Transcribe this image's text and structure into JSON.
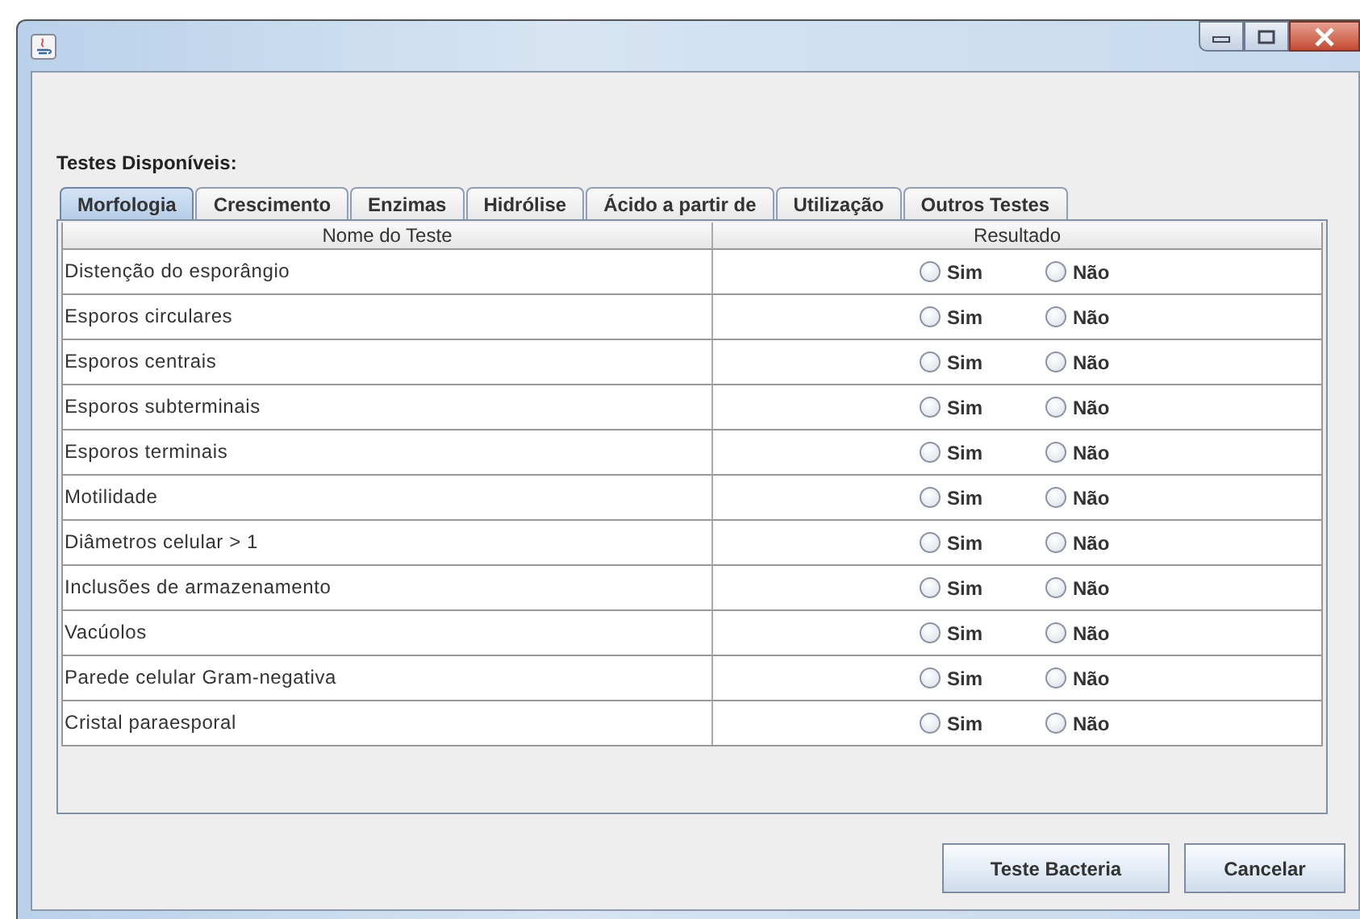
{
  "section_label": "Testes Disponíveis:",
  "tabs": [
    {
      "label": "Morfologia",
      "selected": true
    },
    {
      "label": "Crescimento",
      "selected": false
    },
    {
      "label": "Enzimas",
      "selected": false
    },
    {
      "label": "Hidrólise",
      "selected": false
    },
    {
      "label": "Ácido a partir de",
      "selected": false
    },
    {
      "label": "Utilização",
      "selected": false
    },
    {
      "label": "Outros Testes",
      "selected": false
    }
  ],
  "table": {
    "columns": [
      "Nome do Teste",
      "Resultado"
    ],
    "rows": [
      {
        "name": "Distenção do esporângio",
        "options": [
          {
            "label": "Sim",
            "selected": false
          },
          {
            "label": "Não",
            "selected": false
          }
        ]
      },
      {
        "name": "Esporos circulares",
        "options": [
          {
            "label": "Sim",
            "selected": false
          },
          {
            "label": "Não",
            "selected": false
          }
        ]
      },
      {
        "name": "Esporos centrais",
        "options": [
          {
            "label": "Sim",
            "selected": false
          },
          {
            "label": "Não",
            "selected": false
          }
        ]
      },
      {
        "name": "Esporos subterminais",
        "options": [
          {
            "label": "Sim",
            "selected": false
          },
          {
            "label": "Não",
            "selected": false
          }
        ]
      },
      {
        "name": "Esporos terminais",
        "options": [
          {
            "label": "Sim",
            "selected": false
          },
          {
            "label": "Não",
            "selected": false
          }
        ]
      },
      {
        "name": "Motilidade",
        "options": [
          {
            "label": "Sim",
            "selected": false
          },
          {
            "label": "Não",
            "selected": false
          }
        ]
      },
      {
        "name": "Diâmetros celular > 1",
        "options": [
          {
            "label": "Sim",
            "selected": false
          },
          {
            "label": "Não",
            "selected": false
          }
        ]
      },
      {
        "name": "Inclusões de armazenamento",
        "options": [
          {
            "label": "Sim",
            "selected": false
          },
          {
            "label": "Não",
            "selected": false
          }
        ]
      },
      {
        "name": "Vacúolos",
        "options": [
          {
            "label": "Sim",
            "selected": false
          },
          {
            "label": "Não",
            "selected": false
          }
        ]
      },
      {
        "name": "Parede celular Gram-negativa",
        "options": [
          {
            "label": "Sim",
            "selected": false
          },
          {
            "label": "Não",
            "selected": false
          }
        ]
      },
      {
        "name": "Cristal paraesporal",
        "options": [
          {
            "label": "Sim",
            "selected": false
          },
          {
            "label": "Não",
            "selected": false
          }
        ]
      }
    ]
  },
  "buttons": [
    "Teste Bacteria",
    "Cancelar"
  ]
}
